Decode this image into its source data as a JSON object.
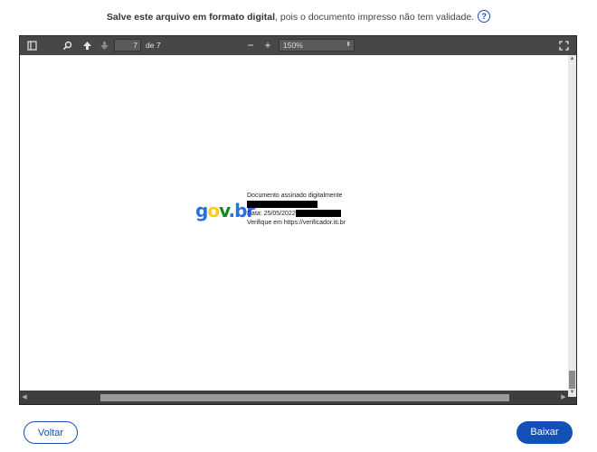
{
  "notice": {
    "bold_text": "Salve este arquivo em formato digital",
    "rest_text": ", pois o documento impresso não tem validade."
  },
  "toolbar": {
    "current_page": "7",
    "page_of": "de 7",
    "zoom_value": "150%"
  },
  "document": {
    "logo": {
      "g": "g",
      "o": "o",
      "v": "v",
      "dot": ".",
      "br": "br"
    },
    "line1": "Documento assinado digitalmente",
    "line3_label": "Data: 25/05/2022",
    "line4": "Verifique em https://verificador.iti.br"
  },
  "actions": {
    "back_label": "Voltar",
    "download_label": "Baixar"
  },
  "colors": {
    "primary": "#1351b4",
    "toolbar": "#474747"
  }
}
